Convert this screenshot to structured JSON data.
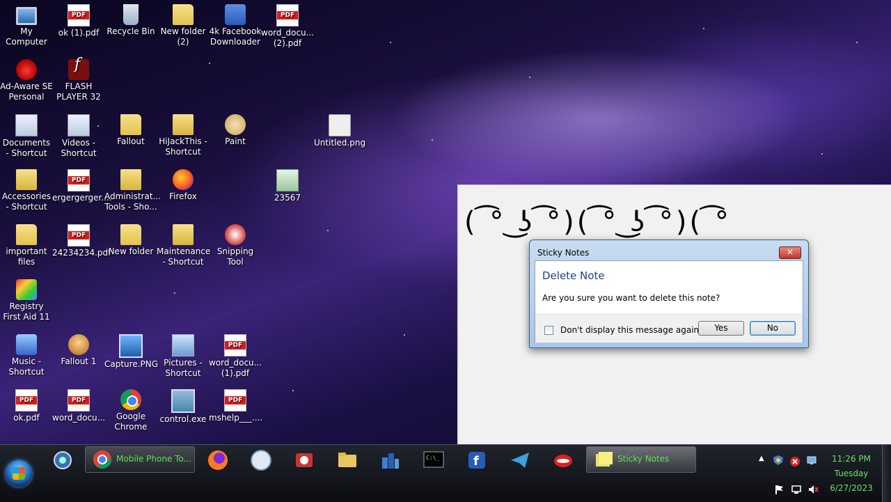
{
  "desktop_icons": [
    {
      "label": "My Computer",
      "icon": "computer-icon",
      "type": "computer",
      "col": 0,
      "row": 0
    },
    {
      "label": "ok (1).pdf",
      "icon": "pdf-icon",
      "type": "pdf",
      "col": 1,
      "row": 0
    },
    {
      "label": "Recycle Bin",
      "icon": "recycle-bin-icon",
      "type": "bin",
      "col": 2,
      "row": 0
    },
    {
      "label": "New folder (2)",
      "icon": "folder-icon",
      "type": "folder",
      "col": 3,
      "row": 0
    },
    {
      "label": "4k Facebook Downloader",
      "icon": "facebook-downloader-icon",
      "type": "fb",
      "col": 4,
      "row": 0
    },
    {
      "label": "word_docu... (2).pdf",
      "icon": "pdf-icon",
      "type": "pdf",
      "col": 5,
      "row": 0
    },
    {
      "label": "Ad-Aware SE Personal",
      "icon": "adaware-icon",
      "type": "lips",
      "col": 0,
      "row": 1
    },
    {
      "label": "FLASH PLAYER 32",
      "icon": "flash-icon",
      "type": "flash",
      "col": 1,
      "row": 1
    },
    {
      "label": "Documents - Shortcut",
      "icon": "documents-icon",
      "type": "doc",
      "col": 0,
      "row": 2
    },
    {
      "label": "Videos - Shortcut",
      "icon": "videos-icon",
      "type": "doc",
      "col": 1,
      "row": 2
    },
    {
      "label": "Fallout",
      "icon": "folder-icon",
      "type": "folder",
      "col": 2,
      "row": 2
    },
    {
      "label": "HiJackThis - Shortcut",
      "icon": "hijackthis-icon",
      "type": "folder-doc",
      "col": 3,
      "row": 2
    },
    {
      "label": "Paint",
      "icon": "paint-icon",
      "type": "paint",
      "col": 4,
      "row": 2
    },
    {
      "label": "Untitled.png",
      "icon": "image-icon",
      "type": "png",
      "col": 6,
      "row": 2
    },
    {
      "label": "Accessories - Shortcut",
      "icon": "accessories-icon",
      "type": "folder-doc",
      "col": 0,
      "row": 3
    },
    {
      "label": "ergergerger....",
      "icon": "pdf-icon",
      "type": "pdf",
      "col": 1,
      "row": 3
    },
    {
      "label": "Administrat... Tools - Sho...",
      "icon": "admin-tools-icon",
      "type": "folder-doc",
      "col": 2,
      "row": 3
    },
    {
      "label": "Firefox",
      "icon": "firefox-icon",
      "type": "firefox",
      "col": 3,
      "row": 3
    },
    {
      "label": "23567",
      "icon": "spreadsheet-icon",
      "type": "sheet",
      "col": 5,
      "row": 3
    },
    {
      "label": "important files",
      "icon": "folder-icon",
      "type": "folder",
      "col": 0,
      "row": 4
    },
    {
      "label": "24234234.pdf",
      "icon": "pdf-icon",
      "type": "pdf",
      "col": 1,
      "row": 4
    },
    {
      "label": "New folder",
      "icon": "folder-icon",
      "type": "folder",
      "col": 2,
      "row": 4
    },
    {
      "label": "Maintenance - Shortcut",
      "icon": "maintenance-icon",
      "type": "folder-doc",
      "col": 3,
      "row": 4
    },
    {
      "label": "Snipping Tool",
      "icon": "scissors-icon",
      "type": "scissors",
      "col": 4,
      "row": 4
    },
    {
      "label": "Registry First Aid 11",
      "icon": "registry-icon",
      "type": "reg",
      "col": 0,
      "row": 5
    },
    {
      "label": "Music - Shortcut",
      "icon": "music-icon",
      "type": "music",
      "col": 0,
      "row": 6
    },
    {
      "label": "Fallout 1",
      "icon": "fallout-icon",
      "type": "fallout",
      "col": 1,
      "row": 6
    },
    {
      "label": "Capture.PNG",
      "icon": "image-icon",
      "type": "capture",
      "col": 2,
      "row": 6
    },
    {
      "label": "Pictures - Shortcut",
      "icon": "pictures-icon",
      "type": "pictures",
      "col": 3,
      "row": 6
    },
    {
      "label": "word_docu... (1).pdf",
      "icon": "pdf-icon",
      "type": "pdf",
      "col": 4,
      "row": 6
    },
    {
      "label": "ok.pdf",
      "icon": "pdf-icon",
      "type": "pdf",
      "col": 0,
      "row": 7
    },
    {
      "label": "word_docu...",
      "icon": "pdf-icon",
      "type": "pdf",
      "col": 1,
      "row": 7
    },
    {
      "label": "Google Chrome",
      "icon": "chrome-icon",
      "type": "chrome",
      "col": 2,
      "row": 7
    },
    {
      "label": "control.exe",
      "icon": "control-icon",
      "type": "control",
      "col": 3,
      "row": 7
    },
    {
      "label": "mshelp___....",
      "icon": "pdf-icon",
      "type": "pdf",
      "col": 4,
      "row": 7
    }
  ],
  "sticky_note": {
    "text": "( ͡° ͜ʖ ͡°)( ͡° ͜ʖ ͡°)( ͡°"
  },
  "dialog": {
    "title": "Sticky Notes",
    "close_label": "✕",
    "heading": "Delete Note",
    "message": "Are you sure you want to delete this note?",
    "checkbox_label": "Don't display this message again",
    "yes_label": "Yes",
    "no_label": "No"
  },
  "taskbar": {
    "chrome_task_label": "Mobile Phone To...",
    "sticky_task_label": "Sticky Notes",
    "clock_time": "11:26 PM",
    "clock_day": "Tuesday",
    "clock_date": "6/27/2023"
  }
}
